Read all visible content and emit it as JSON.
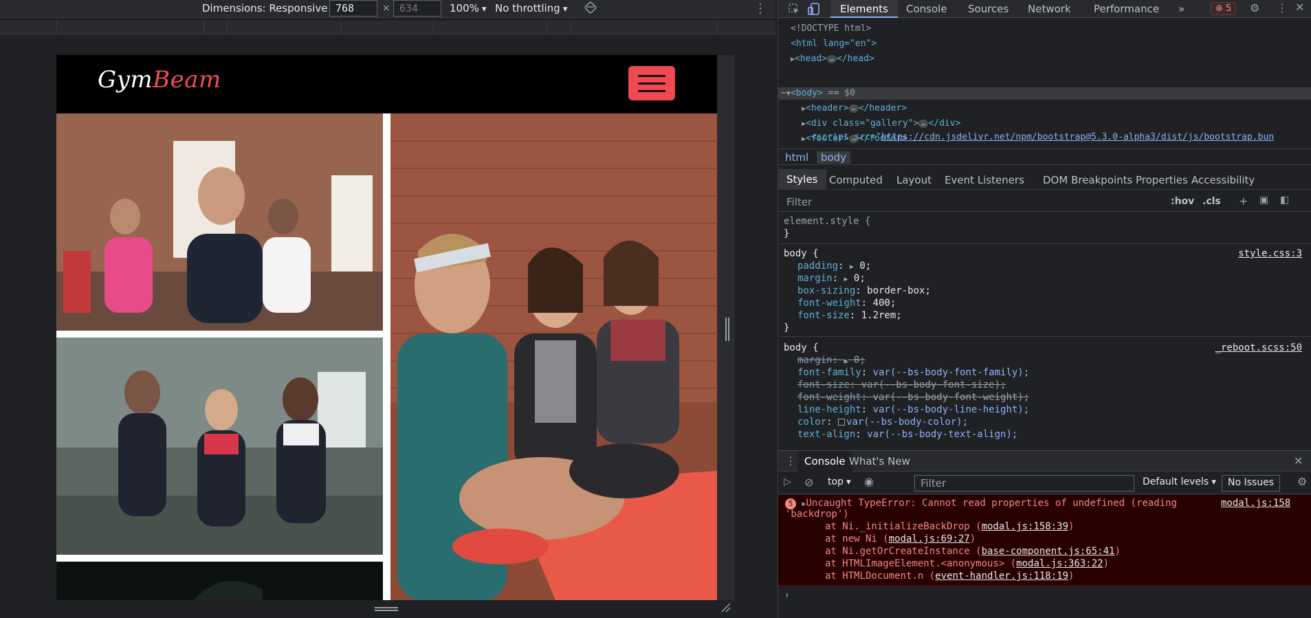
{
  "emulation": {
    "dimensions_label": "Dimensions: Responsive",
    "width_value": "768",
    "height_placeholder": "634",
    "times": "×",
    "zoom": "100%",
    "throttling": "No throttling"
  },
  "site": {
    "logo_part1": "Gym",
    "logo_part2": "Beam",
    "accent_color": "#f24d53"
  },
  "devtools": {
    "tabs": [
      "Elements",
      "Console",
      "Sources",
      "Network",
      "Performance"
    ],
    "more_tabs": "»",
    "error_count": "5",
    "dom": {
      "doctype": "<!DOCTYPE html>",
      "html_open": "<html lang=\"en\">",
      "head": "<head>",
      "head_close": "</head>",
      "body_open": "<body>",
      "body_eq": "== $0",
      "header_open": "<header>",
      "header_close": "</header>",
      "gallery_open": "<div class=\"gallery\">",
      "gallery_close": "</div>",
      "footer_open": "<footer>",
      "footer_close": "</footer>",
      "script_tag_start": "<script src=\"",
      "script_src": "https://cdn.jsdelivr.net/npm/bootstrap@5.3.0-alpha3/dist/js/bootstrap.bun"
    },
    "breadcrumb": [
      "html",
      "body"
    ],
    "sub_tabs": [
      "Styles",
      "Computed",
      "Layout",
      "Event Listeners",
      "DOM Breakpoints",
      "Properties",
      "Accessibility"
    ],
    "filter_placeholder": "Filter",
    "hov": ":hov",
    "cls": ".cls",
    "styles": {
      "element_style": "element.style {",
      "close": "}",
      "rule1_selector": "body {",
      "rule1_source": "style.css:3",
      "rule1_props": [
        {
          "name": "padding",
          "value": "0;",
          "expand": true
        },
        {
          "name": "margin",
          "value": "0;",
          "expand": true
        },
        {
          "name": "box-sizing",
          "value": "border-box;"
        },
        {
          "name": "font-weight",
          "value": "400;"
        },
        {
          "name": "font-size",
          "value": "1.2rem;"
        }
      ],
      "rule2_selector": "body {",
      "rule2_source": "_reboot.scss:50",
      "rule2_props": [
        {
          "name": "margin",
          "value": "0;",
          "struck": true
        },
        {
          "name": "font-family",
          "value": "var(--bs-body-font-family);"
        },
        {
          "name": "font-size",
          "value": "var(--bs-body-font-size);",
          "struck": true
        },
        {
          "name": "font-weight",
          "value": "var(--bs-body-font-weight);",
          "struck": true
        },
        {
          "name": "line-height",
          "value": "var(--bs-body-line-height);"
        },
        {
          "name": "color",
          "value": "var(--bs-body-color);"
        },
        {
          "name": "text-align",
          "value": "var(--bs-body-text-align);"
        }
      ]
    },
    "console": {
      "tabs": [
        "Console",
        "What's New"
      ],
      "context": "top",
      "filter_placeholder": "Filter",
      "levels": "Default levels",
      "issues": "No Issues",
      "error_count": "5",
      "error_title": "Uncaught TypeError: Cannot read properties of undefined (reading",
      "error_title2": "'backdrop')",
      "error_source": "modal.js:158",
      "stack": [
        {
          "prefix": "at Ni._initializeBackDrop (",
          "link": "modal.js:158:39",
          "suffix": ")"
        },
        {
          "prefix": "at new Ni (",
          "link": "modal.js:69:27",
          "suffix": ")"
        },
        {
          "prefix": "at Ni.getOrCreateInstance (",
          "link": "base-component.js:65:41",
          "suffix": ")"
        },
        {
          "prefix": "at HTMLImageElement.<anonymous> (",
          "link": "modal.js:363:22",
          "suffix": ")"
        },
        {
          "prefix": "at HTMLDocument.n (",
          "link": "event-handler.js:118:19",
          "suffix": ")"
        }
      ],
      "prompt": "›"
    }
  }
}
